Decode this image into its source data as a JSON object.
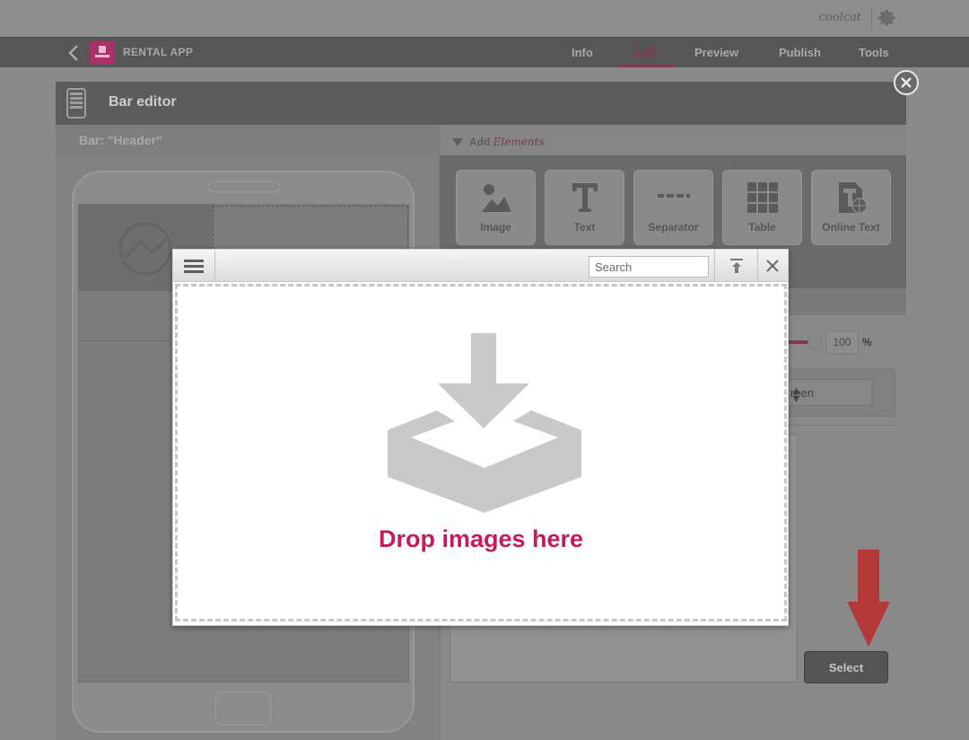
{
  "user": {
    "name": "coolcat"
  },
  "app": {
    "name": "RENTAL APP"
  },
  "nav": {
    "tabs": [
      {
        "label": "Info"
      },
      {
        "label": "Edit"
      },
      {
        "label": "Preview"
      },
      {
        "label": "Publish"
      },
      {
        "label": "Tools"
      }
    ],
    "active_tab": "Edit",
    "accent_color": "#7c3a57"
  },
  "editor": {
    "title": "Bar editor",
    "bar_label": "Bar: \"Header\"",
    "add_prefix": "Add",
    "add_label": "Elements",
    "elements": [
      {
        "label": "Image",
        "icon": "image-icon"
      },
      {
        "label": "Text",
        "icon": "text-icon"
      },
      {
        "label": "Separator",
        "icon": "separator-icon"
      },
      {
        "label": "Table",
        "icon": "table-icon"
      },
      {
        "label": "Online Text",
        "icon": "online-text-icon"
      }
    ],
    "opacity_value": "100",
    "opacity_unit": "%",
    "color_select_value": "reen",
    "select_button": "Select"
  },
  "dialog": {
    "search_placeholder": "Search",
    "drop_text": "Drop images here",
    "drop_text_color": "#c71a5e"
  }
}
